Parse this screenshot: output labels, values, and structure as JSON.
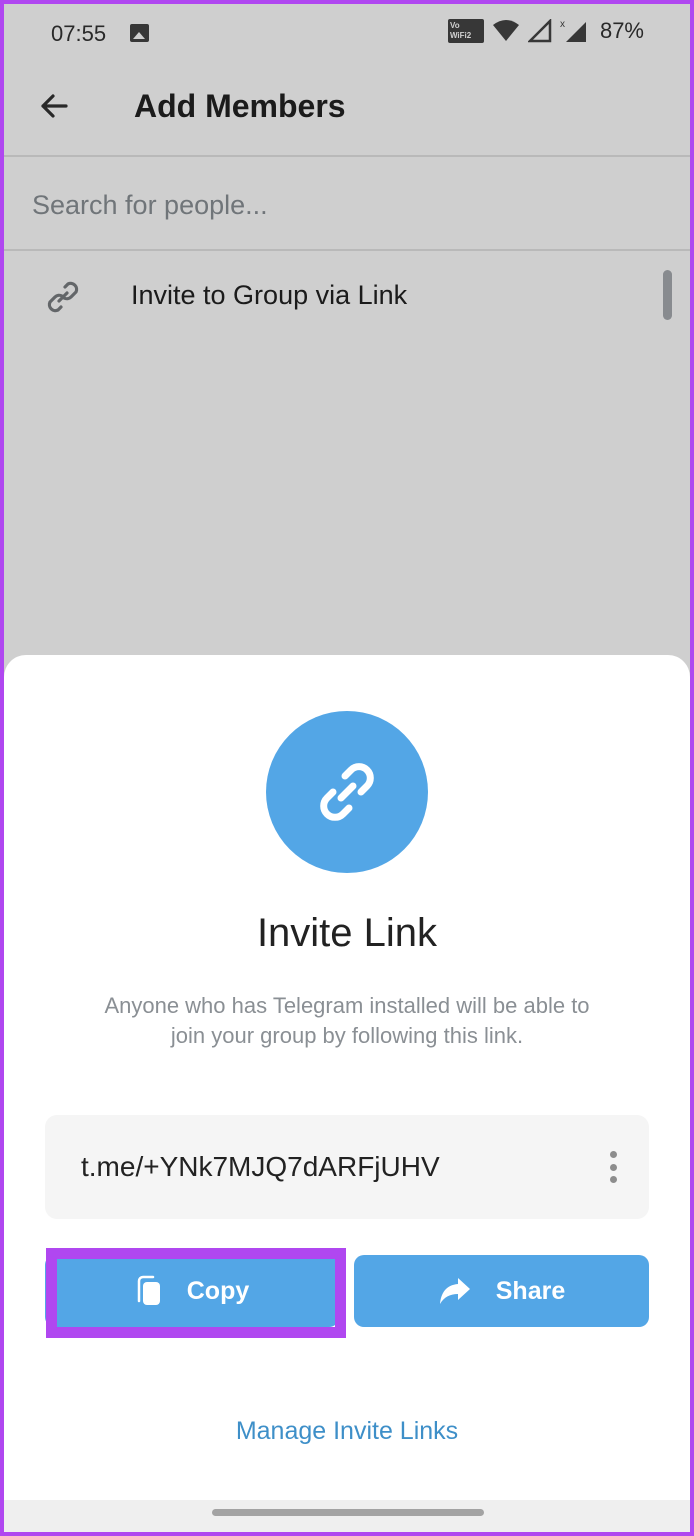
{
  "status_bar": {
    "time": "07:55",
    "notification_icon": "image-icon",
    "vowifi_label": "Vo WiFi 2",
    "icons": [
      "vowifi-icon",
      "wifi-icon",
      "signal-empty-icon",
      "signal-x-icon"
    ],
    "battery": "87%"
  },
  "app_bar": {
    "back_icon": "arrow-left-icon",
    "title": "Add Members"
  },
  "search": {
    "placeholder": "Search for people...",
    "value": ""
  },
  "list": {
    "items": [
      {
        "icon": "link-icon",
        "label": "Invite to Group via Link"
      }
    ]
  },
  "sheet": {
    "icon": "link-icon",
    "title": "Invite Link",
    "description": "Anyone who has Telegram installed will be able to join your group by following this link.",
    "link": "t.me/+YNk7MJQ7dARFjUHV",
    "more_icon": "more-vertical-icon",
    "buttons": {
      "copy": {
        "label": "Copy",
        "icon": "copy-icon"
      },
      "share": {
        "label": "Share",
        "icon": "share-arrow-icon"
      }
    },
    "manage_link": "Manage Invite Links",
    "accent_color": "#53a6e6",
    "highlight_color": "#b047f0"
  }
}
